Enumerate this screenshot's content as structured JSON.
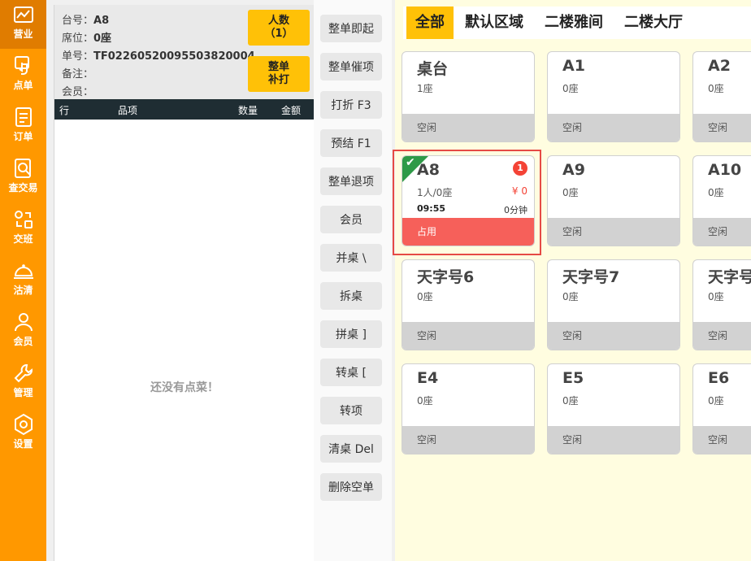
{
  "sidebar": {
    "items": [
      {
        "label": "营业",
        "icon": "chart-icon"
      },
      {
        "label": "点单",
        "icon": "touch-icon"
      },
      {
        "label": "订单",
        "icon": "document-icon"
      },
      {
        "label": "查交易",
        "icon": "search-document-icon"
      },
      {
        "label": "交班",
        "icon": "shift-icon"
      },
      {
        "label": "沽清",
        "icon": "cloche-icon"
      },
      {
        "label": "会员",
        "icon": "user-icon"
      },
      {
        "label": "管理",
        "icon": "wrench-icon"
      },
      {
        "label": "设置",
        "icon": "gear-icon"
      }
    ]
  },
  "order": {
    "table_label": "台号：",
    "table_value": "A8",
    "seat_label": "席位：",
    "seat_value": "0座",
    "number_label": "单号：",
    "number_value": "TF02260520095503820004",
    "note_label": "备注：",
    "member_label": "会员：",
    "people_button": {
      "line1": "人数",
      "line2": "（1）"
    },
    "reprint_button": {
      "line1": "整单",
      "line2": "补打"
    },
    "columns": {
      "row": "行",
      "item": "品项",
      "qty": "数量",
      "amount": "金额"
    },
    "empty_text": "还没有点菜！"
  },
  "actions": [
    "整单即起",
    "整单催项",
    "打折 F3",
    "预结 F1",
    "整单退项",
    "会员",
    "并桌 \\",
    "拆桌",
    "拼桌 ]",
    "转桌 [",
    "转项",
    "清桌 Del",
    "删除空单"
  ],
  "area": {
    "tabs": [
      "全部",
      "默认区域",
      "二楼雅间",
      "二楼大厅"
    ],
    "cards": [
      {
        "name": "桌台",
        "seats": "1座",
        "status": "空闲"
      },
      {
        "name": "A1",
        "seats": "0座",
        "status": "空闲"
      },
      {
        "name": "A2",
        "seats": "0座",
        "status": "空闲"
      },
      {
        "name": "A8",
        "seats": "1人/0座",
        "status": "占用",
        "price": "¥ 0",
        "time": "09:55",
        "duration": "0分钟",
        "badge": "1"
      },
      {
        "name": "A9",
        "seats": "0座",
        "status": "空闲"
      },
      {
        "name": "A10",
        "seats": "0座",
        "status": "空闲"
      },
      {
        "name": "天字号6",
        "seats": "0座",
        "status": "空闲"
      },
      {
        "name": "天字号7",
        "seats": "0座",
        "status": "空闲"
      },
      {
        "name": "天字号",
        "seats": "0座",
        "status": "空闲"
      },
      {
        "name": "E4",
        "seats": "0座",
        "status": "空闲"
      },
      {
        "name": "E5",
        "seats": "0座",
        "status": "空闲"
      },
      {
        "name": "E6",
        "seats": "0座",
        "status": "空闲"
      }
    ]
  },
  "colors": {
    "sidebar": "#ff9800",
    "accent": "#ffc107",
    "occupied": "#f6605a",
    "selected_outline": "#e64a45",
    "check": "#2e9a47"
  }
}
